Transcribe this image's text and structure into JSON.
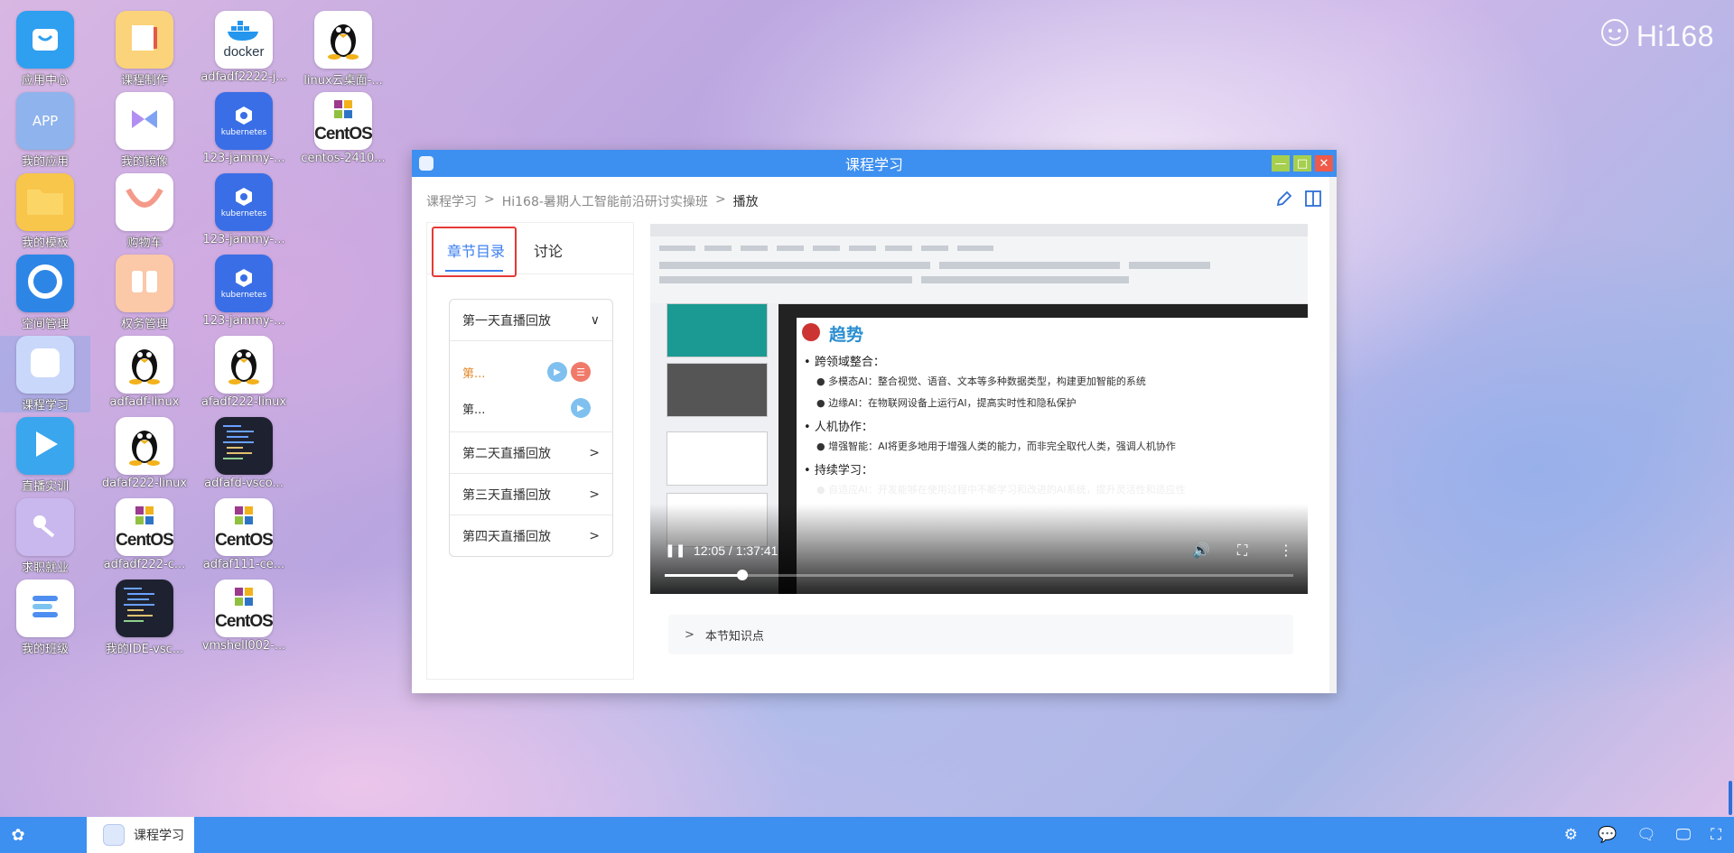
{
  "brand": {
    "logo_text": "Hi168"
  },
  "desktop": {
    "icons": [
      {
        "label": "应用中心",
        "kind": "app-center"
      },
      {
        "label": "我的应用",
        "kind": "my-apps",
        "tile_text": "APP"
      },
      {
        "label": "我的模板",
        "kind": "folder"
      },
      {
        "label": "空间管理",
        "kind": "space"
      },
      {
        "label": "课程学习",
        "kind": "course",
        "selected": true
      },
      {
        "label": "直播实训",
        "kind": "live"
      },
      {
        "label": "求职就业",
        "kind": "jobs"
      },
      {
        "label": "我的班级",
        "kind": "class"
      },
      {
        "label": "课程制作",
        "kind": "course-make"
      },
      {
        "label": "我的镜像",
        "kind": "images"
      },
      {
        "label": "购物车",
        "kind": "cart"
      },
      {
        "label": "权务管理",
        "kind": "tasks"
      },
      {
        "label": "adfadf-linux",
        "kind": "linux"
      },
      {
        "label": "dafaf222-linux",
        "kind": "linux"
      },
      {
        "label": "adfadf222-c...",
        "kind": "centos"
      },
      {
        "label": "我的IDE-vsc...",
        "kind": "ide"
      },
      {
        "label": "adfadf2222-j...",
        "kind": "docker"
      },
      {
        "label": "123-jammy-...",
        "kind": "k8s"
      },
      {
        "label": "123-jammy-...",
        "kind": "k8s"
      },
      {
        "label": "123-jammy-...",
        "kind": "k8s"
      },
      {
        "label": "afadf222-linux",
        "kind": "linux"
      },
      {
        "label": "adfafd-vsco...",
        "kind": "ide"
      },
      {
        "label": "adfaf111-ce...",
        "kind": "centos"
      },
      {
        "label": "vmshell002-...",
        "kind": "centos"
      },
      {
        "label": "linux云桌面-...",
        "kind": "linux"
      },
      {
        "label": "centos-2410...",
        "kind": "centos"
      }
    ],
    "k8s_text": "kubernetes",
    "docker_text": "docker",
    "centos_text": "CentOS"
  },
  "window": {
    "title": "课程学习",
    "controls": {
      "minimize": "—",
      "maximize": "□",
      "close": "✕"
    },
    "breadcrumb": [
      "课程学习",
      "Hi168-暑期人工智能前沿研讨实操班",
      "播放"
    ],
    "breadcrumb_sep": ">",
    "tabs": {
      "active": "章节目录",
      "other": "讨论"
    },
    "chapters": [
      {
        "title": "第一天直播回放",
        "expanded": true,
        "chevron": "∨"
      },
      {
        "title": "第二天直播回放",
        "expanded": false,
        "chevron": ">"
      },
      {
        "title": "第三天直播回放",
        "expanded": false,
        "chevron": ">"
      },
      {
        "title": "第四天直播回放",
        "expanded": false,
        "chevron": ">"
      }
    ],
    "sub_items": [
      "第...",
      "第..."
    ],
    "video": {
      "current_time": "12:05",
      "duration": "1:37:41",
      "time_display": "12:05 / 1:37:41",
      "progress": 0.123,
      "slide_title": "趋势",
      "slide_lines": [
        {
          "level": 1,
          "text": "跨领域整合："
        },
        {
          "level": 2,
          "text": "多模态AI：整合视觉、语音、文本等多种数据类型，构建更加智能的系统"
        },
        {
          "level": 2,
          "text": "边缘AI：在物联网设备上运行AI，提高实时性和隐私保护"
        },
        {
          "level": 1,
          "text": "人机协作："
        },
        {
          "level": 2,
          "text": "增强智能：AI将更多地用于增强人类的能力，而非完全取代人类，强调人机协作"
        },
        {
          "level": 1,
          "text": "持续学习："
        },
        {
          "level": 2,
          "text": "自适应AI：开发能够在使用过程中不断学习和改进的AI系统，提升灵活性和适应性"
        }
      ]
    },
    "knowledge_label": "本节知识点"
  },
  "taskbar": {
    "app_label": "课程学习",
    "tray_icons": [
      "settings-icon",
      "wechat-icon",
      "chat-icon",
      "monitor-icon",
      "fullscreen-icon"
    ]
  }
}
